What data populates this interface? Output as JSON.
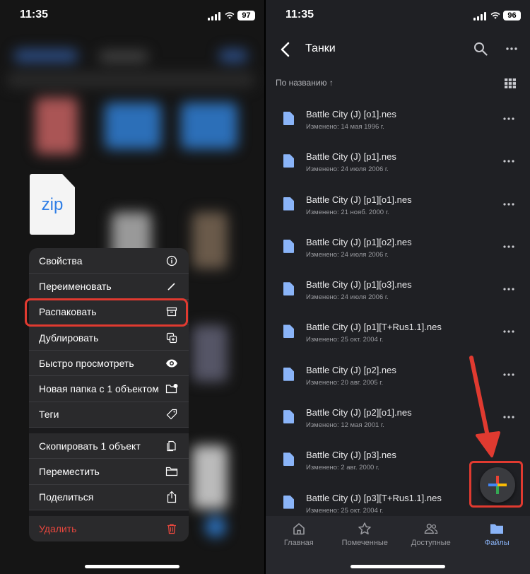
{
  "left": {
    "status": {
      "time": "11:35",
      "battery": "97"
    },
    "file": {
      "label": "zip"
    },
    "menu": {
      "group1": [
        {
          "label": "Свойства",
          "icon": "info-icon"
        },
        {
          "label": "Переименовать",
          "icon": "pencil-icon"
        },
        {
          "label": "Распаковать",
          "icon": "archive-icon"
        },
        {
          "label": "Дублировать",
          "icon": "duplicate-icon"
        },
        {
          "label": "Быстро просмотреть",
          "icon": "eye-icon"
        },
        {
          "label": "Новая папка с 1 объектом",
          "icon": "folder-badge-icon"
        },
        {
          "label": "Теги",
          "icon": "tag-icon"
        }
      ],
      "group2": [
        {
          "label": "Скопировать 1 объект",
          "icon": "copy-icon"
        },
        {
          "label": "Переместить",
          "icon": "folder-icon"
        },
        {
          "label": "Поделиться",
          "icon": "share-icon"
        }
      ],
      "delete": {
        "label": "Удалить",
        "icon": "trash-icon"
      }
    },
    "highlight_color": "#e03a30"
  },
  "right": {
    "status": {
      "time": "11:35",
      "battery": "96"
    },
    "nav": {
      "title": "Танки"
    },
    "sort": {
      "label": "По названию"
    },
    "files": [
      {
        "name": "Battle City (J) [o1].nes",
        "date": "Изменено: 14 мая 1996 г."
      },
      {
        "name": "Battle City (J) [p1].nes",
        "date": "Изменено: 24 июля 2006 г."
      },
      {
        "name": "Battle City (J) [p1][o1].nes",
        "date": "Изменено: 21 нояб. 2000 г."
      },
      {
        "name": "Battle City (J) [p1][o2].nes",
        "date": "Изменено: 24 июля 2006 г."
      },
      {
        "name": "Battle City (J) [p1][o3].nes",
        "date": "Изменено: 24 июля 2006 г."
      },
      {
        "name": "Battle City (J) [p1][T+Rus1.1].nes",
        "date": "Изменено: 25 окт. 2004 г."
      },
      {
        "name": "Battle City (J) [p2].nes",
        "date": "Изменено: 20 авг. 2005 г."
      },
      {
        "name": "Battle City (J) [p2][o1].nes",
        "date": "Изменено: 12 мая 2001 г."
      },
      {
        "name": "Battle City (J) [p3].nes",
        "date": "Изменено: 2 авг. 2000 г."
      },
      {
        "name": "Battle City (J) [p3][T+Rus1.1].nes",
        "date": "Изменено: 25 окт. 2004 г."
      }
    ],
    "tabs": [
      {
        "label": "Главная",
        "icon": "home-icon",
        "active": false
      },
      {
        "label": "Помеченные",
        "icon": "star-icon",
        "active": false
      },
      {
        "label": "Доступные",
        "icon": "people-icon",
        "active": false
      },
      {
        "label": "Файлы",
        "icon": "folder-icon",
        "active": true
      }
    ],
    "accent": "#8ab4f8"
  }
}
